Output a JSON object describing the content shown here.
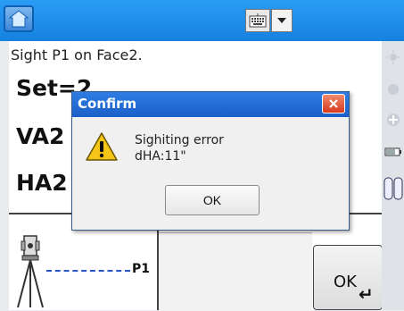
{
  "main": {
    "instruction": "Sight P1 on Face2.",
    "set_label": "Set=2",
    "va_label": "VA2",
    "ha_label": "HA2",
    "target_label": "P1",
    "ok_button_label": "OK"
  },
  "dialog": {
    "title": "Confirm",
    "message_line1": "Sighiting error",
    "message_line2": "dHA:11\"",
    "ok_label": "OK"
  },
  "icons": {
    "home": "home-icon",
    "keyboard": "keyboard-icon",
    "dropdown": "chevron-down-icon",
    "close": "close-icon",
    "warning": "warning-icon",
    "instrument": "total-station-icon",
    "enter": "enter-icon"
  },
  "colors": {
    "topbar": "#1681df",
    "dialog_title": "#1a5fc8",
    "close_button": "#d7391b",
    "warning": "#f5c518",
    "target_line": "#2a57c6"
  }
}
